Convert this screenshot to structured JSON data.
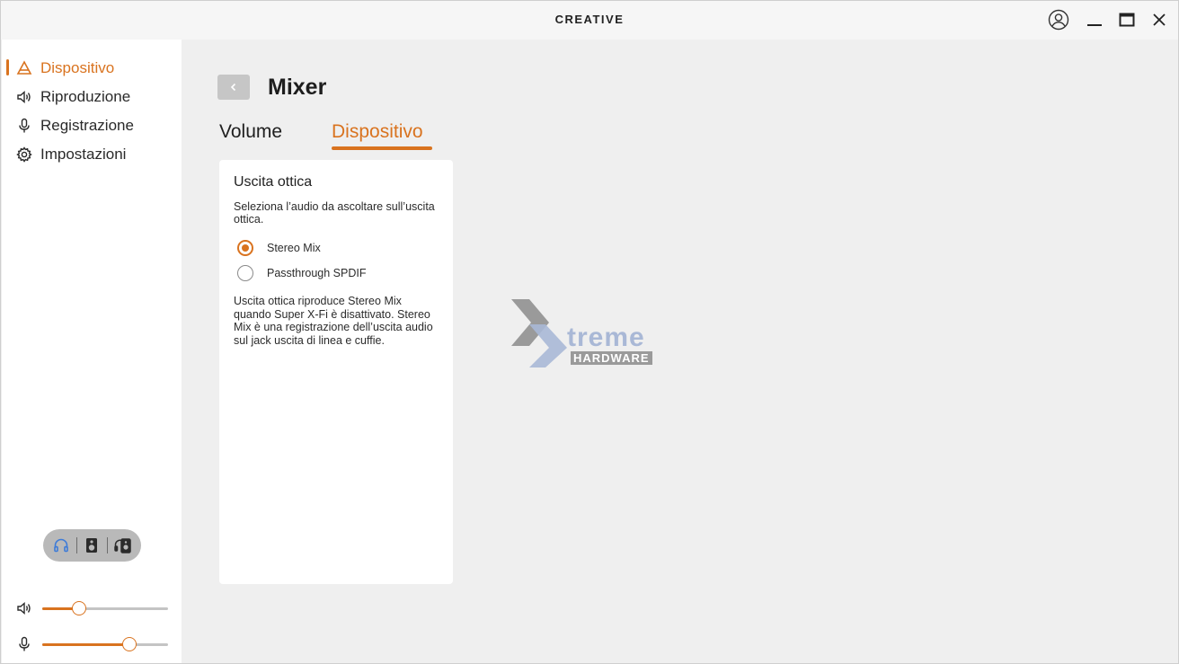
{
  "app": {
    "brand": "CREATIVE"
  },
  "sidebar": {
    "items": [
      {
        "label": "Dispositivo",
        "icon": "device-icon",
        "active": true
      },
      {
        "label": "Riproduzione",
        "icon": "speaker-icon",
        "active": false
      },
      {
        "label": "Registrazione",
        "icon": "microphone-icon",
        "active": false
      },
      {
        "label": "Impostazioni",
        "icon": "gear-icon",
        "active": false
      }
    ],
    "output_modes": [
      {
        "icon": "headphones-icon",
        "selected": true
      },
      {
        "icon": "speaker-box-icon",
        "selected": false
      },
      {
        "icon": "headphones-speaker-icon",
        "selected": false
      }
    ],
    "volume_level": 0.29,
    "mic_level": 0.69
  },
  "main": {
    "title": "Mixer",
    "tabs": [
      {
        "label": "Volume",
        "active": false
      },
      {
        "label": "Dispositivo",
        "active": true
      }
    ],
    "card": {
      "title": "Uscita ottica",
      "description": "Seleziona l’audio da ascoltare sull’uscita ottica.",
      "options": [
        {
          "label": "Stereo Mix",
          "checked": true
        },
        {
          "label": "Passthrough SPDIF",
          "checked": false
        }
      ],
      "note": "Uscita ottica riproduce Stereo Mix quando Super X-Fi è disattivato. Stereo Mix è una registrazione dell’uscita audio sul jack uscita di linea e cuffie."
    }
  },
  "watermark": {
    "text": "treme",
    "subtext": "HARDWARE"
  },
  "colors": {
    "accent": "#d9731f",
    "toggle_selected": "#3d7bd8"
  }
}
